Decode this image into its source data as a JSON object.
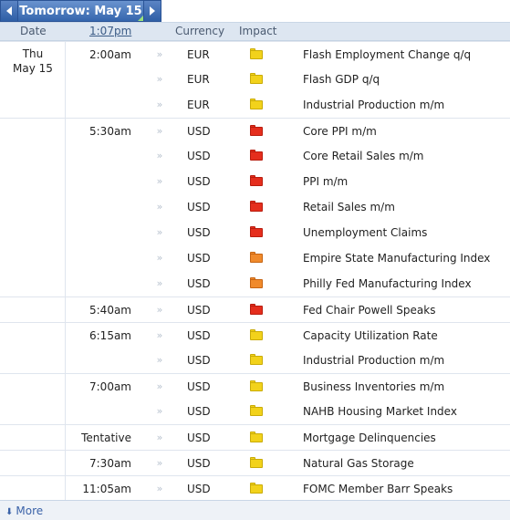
{
  "tab": {
    "label": "Tomorrow: May 15"
  },
  "header": {
    "date": "Date",
    "time": "1:07pm",
    "currency": "Currency",
    "impact": "Impact"
  },
  "day": {
    "dow": "Thu",
    "month_day": "May 15"
  },
  "detail_glyph": "»",
  "impact_colors": {
    "yellow": "#f2d21b",
    "red": "#e52e1d",
    "orange": "#f08a2c"
  },
  "events": [
    {
      "time": "2:00am",
      "currency": "EUR",
      "impact": "yellow",
      "event": "Flash Employment Change q/q"
    },
    {
      "time": "",
      "currency": "EUR",
      "impact": "yellow",
      "event": "Flash GDP q/q"
    },
    {
      "time": "",
      "currency": "EUR",
      "impact": "yellow",
      "event": "Industrial Production m/m"
    },
    {
      "time": "5:30am",
      "currency": "USD",
      "impact": "red",
      "event": "Core PPI m/m"
    },
    {
      "time": "",
      "currency": "USD",
      "impact": "red",
      "event": "Core Retail Sales m/m"
    },
    {
      "time": "",
      "currency": "USD",
      "impact": "red",
      "event": "PPI m/m"
    },
    {
      "time": "",
      "currency": "USD",
      "impact": "red",
      "event": "Retail Sales m/m"
    },
    {
      "time": "",
      "currency": "USD",
      "impact": "red",
      "event": "Unemployment Claims"
    },
    {
      "time": "",
      "currency": "USD",
      "impact": "orange",
      "event": "Empire State Manufacturing Index"
    },
    {
      "time": "",
      "currency": "USD",
      "impact": "orange",
      "event": "Philly Fed Manufacturing Index"
    },
    {
      "time": "5:40am",
      "currency": "USD",
      "impact": "red",
      "event": "Fed Chair Powell Speaks"
    },
    {
      "time": "6:15am",
      "currency": "USD",
      "impact": "yellow",
      "event": "Capacity Utilization Rate"
    },
    {
      "time": "",
      "currency": "USD",
      "impact": "yellow",
      "event": "Industrial Production m/m"
    },
    {
      "time": "7:00am",
      "currency": "USD",
      "impact": "yellow",
      "event": "Business Inventories m/m"
    },
    {
      "time": "",
      "currency": "USD",
      "impact": "yellow",
      "event": "NAHB Housing Market Index"
    },
    {
      "time": "Tentative",
      "currency": "USD",
      "impact": "yellow",
      "event": "Mortgage Delinquencies"
    },
    {
      "time": "7:30am",
      "currency": "USD",
      "impact": "yellow",
      "event": "Natural Gas Storage"
    },
    {
      "time": "11:05am",
      "currency": "USD",
      "impact": "yellow",
      "event": "FOMC Member Barr Speaks"
    }
  ],
  "footer": {
    "more_label": "More"
  }
}
